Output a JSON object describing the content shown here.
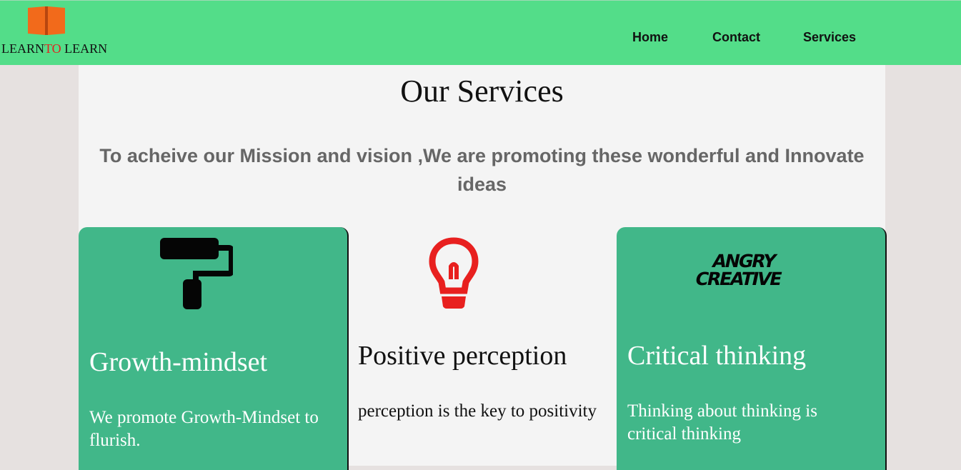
{
  "header": {
    "logo": {
      "text_main": "LEARN",
      "text_accent": "TO",
      "text_end": " LEARN",
      "icon": "open-book-icon",
      "icon_color": "#f26a1b",
      "accent_color": "#e0241f"
    },
    "nav": [
      {
        "label": "Home"
      },
      {
        "label": "Contact"
      },
      {
        "label": "Services"
      }
    ],
    "background_color": "#53dd89"
  },
  "main": {
    "title": "Our Services",
    "subtitle": "To acheive our Mission and vision ,We are promoting these wonderful and Innovate ideas",
    "cards": [
      {
        "icon": "paint-roller-icon",
        "title": "Growth-mindset",
        "text": "We promote Growth-Mindset to flurish.",
        "style": "green"
      },
      {
        "icon": "lightbulb-icon",
        "title": "Positive perception",
        "text": "perception is the key to positivity",
        "style": "plain"
      },
      {
        "icon": "angry-creative-logo",
        "logo_lines": [
          "ANGRY",
          "CREATIVE"
        ],
        "title": "Critical thinking",
        "text": "Thinking about thinking is critical thinking",
        "style": "green"
      }
    ]
  },
  "colors": {
    "card_green": "#41b789",
    "page_bg": "#e6e1e0",
    "content_bg": "#f4f4f4",
    "bulb_red": "#e8201f"
  }
}
